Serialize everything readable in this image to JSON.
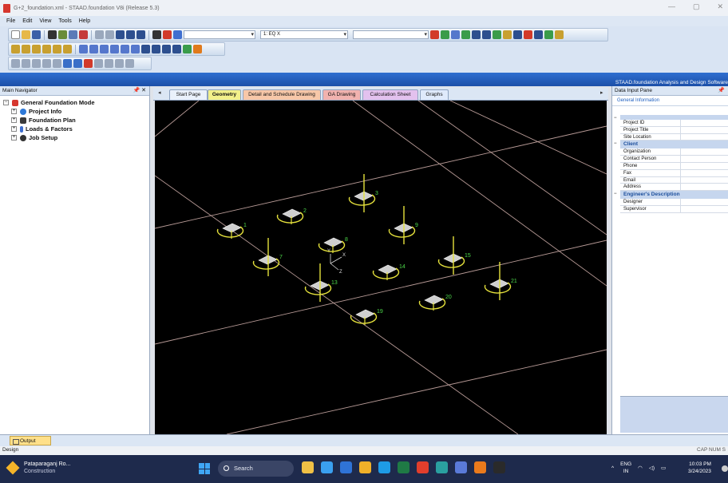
{
  "window": {
    "title": "G+2_foundation.xml - STAAD.foundation V8i (Release 5.3)",
    "controls": [
      "—",
      "▢",
      "✕"
    ]
  },
  "menu": [
    "File",
    "Edit",
    "View",
    "Tools",
    "Help"
  ],
  "toolbar": {
    "combo1_value": "",
    "combo2_value": "1: EQ X",
    "combo3_value": ""
  },
  "band_brand": "STAAD.foundation Analysis and Design Software",
  "navigator": {
    "title": "Main Navigator",
    "pin": "📌 ✕",
    "root": "General Foundation Mode",
    "items": [
      "Project Info",
      "Foundation Plan",
      "Loads & Factors",
      "Job Setup"
    ]
  },
  "tabs": [
    {
      "label": "Start Page",
      "color": "#eaf1fb"
    },
    {
      "label": "Geometry",
      "color": "#f2f08a"
    },
    {
      "label": "Detail and Schedule Drawing",
      "color": "#f7c7a8"
    },
    {
      "label": "GA Drawing",
      "color": "#f1b2ae"
    },
    {
      "label": "Calculation Sheet",
      "color": "#e3c1ee"
    },
    {
      "label": "Graphs",
      "color": "#dfeafb"
    }
  ],
  "viewport": {
    "nodes": [
      {
        "id": "1",
        "hasColumn": false
      },
      {
        "id": "2",
        "hasColumn": false
      },
      {
        "id": "3",
        "hasColumn": true
      },
      {
        "id": "7",
        "hasColumn": true
      },
      {
        "id": "8",
        "hasColumn": false
      },
      {
        "id": "9",
        "hasColumn": true
      },
      {
        "id": "13",
        "hasColumn": true
      },
      {
        "id": "14",
        "hasColumn": false
      },
      {
        "id": "15",
        "hasColumn": true
      },
      {
        "id": "19",
        "hasColumn": false
      },
      {
        "id": "20",
        "hasColumn": false
      },
      {
        "id": "21",
        "hasColumn": true
      }
    ],
    "axis_labels": [
      "Y",
      "X",
      "Z"
    ]
  },
  "data_pane": {
    "title": "Data Input Pane",
    "pin": "📌",
    "section": "General Information",
    "rows_general": [
      "Project ID",
      "Project Title",
      "Site Location"
    ],
    "client_category": "Client",
    "rows_client": [
      "Organization",
      "Contact Person",
      "Phone",
      "Fax",
      "Email",
      "Address"
    ],
    "engineer_category": "Engineer's Description",
    "rows_engineer": [
      "Designer",
      "Supervisor"
    ]
  },
  "output_tab": "Output",
  "status": {
    "left": "Design",
    "right": "CAP NUM S"
  },
  "taskbar": {
    "app_name": "Pataparaganj Ro...",
    "app_sub": "Construction",
    "search": "Search",
    "lang": "ENG",
    "region": "IN",
    "time": "10:03 PM",
    "date": "3/24/2023",
    "pin_colors": [
      "#f0c045",
      "#3aa0f0",
      "#2f73d6",
      "#f0b029",
      "#1e9be6",
      "#1f7a45",
      "#e23e2c",
      "#2aa0a0",
      "#5a7ad8",
      "#ea7a1c",
      "#2a2a2a"
    ]
  }
}
